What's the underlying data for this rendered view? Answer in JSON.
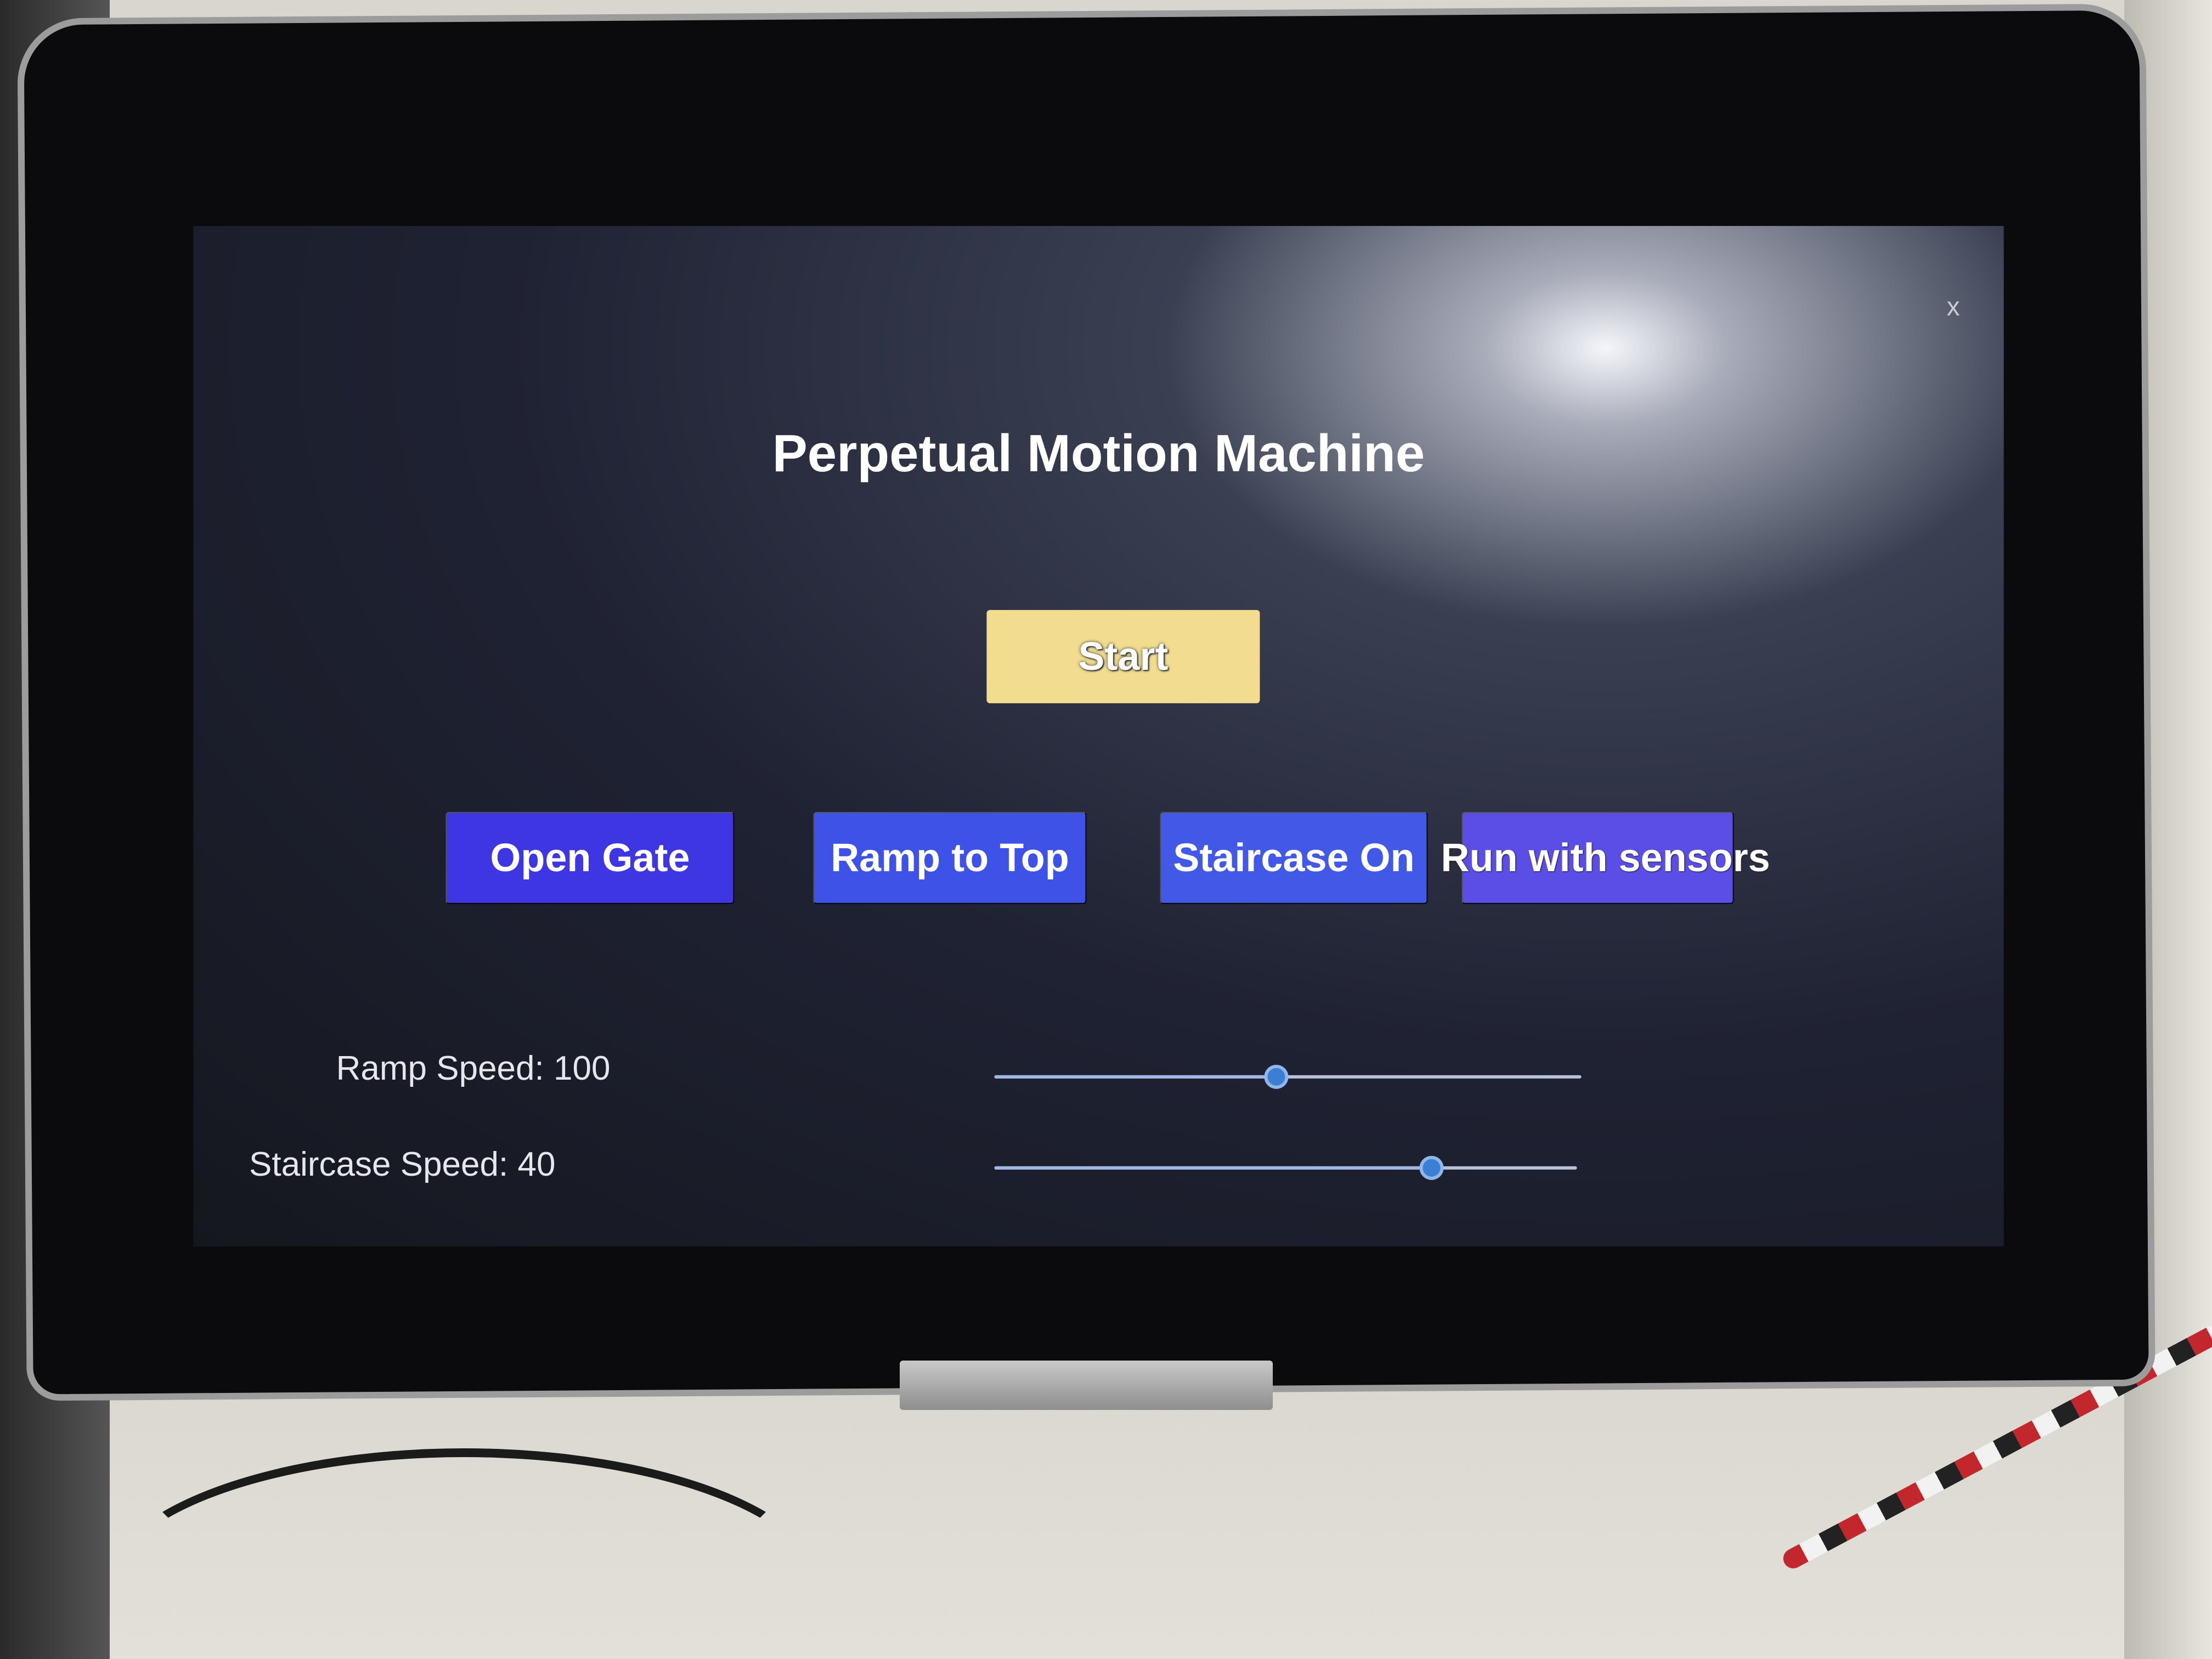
{
  "app": {
    "title": "Perpetual Motion Machine",
    "close_label": "x"
  },
  "start_button": {
    "label": "Start"
  },
  "mode_buttons": [
    {
      "label": "Open Gate"
    },
    {
      "label": "Ramp to Top"
    },
    {
      "label": "Staircase On"
    },
    {
      "label": "Run with sensors"
    }
  ],
  "sliders": {
    "ramp": {
      "label": "Ramp Speed: 100",
      "value_fraction": 0.48
    },
    "staircase": {
      "label": "Staircase Speed: 40",
      "value_fraction": 0.75
    }
  },
  "colors": {
    "start_button": "#f1dc8f",
    "mode_button": "#3d36e2",
    "slider_thumb": "#3b7fd4"
  }
}
